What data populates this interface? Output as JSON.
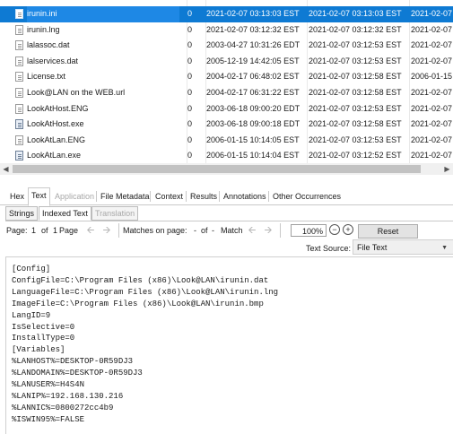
{
  "files": [
    {
      "name": "irunin.ini",
      "size": "0",
      "created": "2021-02-07 03:13:03 EST",
      "modified": "2021-02-07 03:13:03 EST",
      "accessed": "2021-02-07",
      "icon": "doc-icon",
      "selected": true
    },
    {
      "name": "irunin.lng",
      "size": "0",
      "created": "2021-02-07 03:12:32 EST",
      "modified": "2021-02-07 03:12:32 EST",
      "accessed": "2021-02-07",
      "icon": "doc-icon"
    },
    {
      "name": "lalassoc.dat",
      "size": "0",
      "created": "2003-04-27 10:31:26 EDT",
      "modified": "2021-02-07 03:12:53 EST",
      "accessed": "2021-02-07",
      "icon": "doc-icon"
    },
    {
      "name": "lalservices.dat",
      "size": "0",
      "created": "2005-12-19 14:42:05 EST",
      "modified": "2021-02-07 03:12:53 EST",
      "accessed": "2021-02-07",
      "icon": "doc-icon"
    },
    {
      "name": "License.txt",
      "size": "0",
      "created": "2004-02-17 06:48:02 EST",
      "modified": "2021-02-07 03:12:58 EST",
      "accessed": "2006-01-15",
      "icon": "doc-icon"
    },
    {
      "name": "Look@LAN on the WEB.url",
      "size": "0",
      "created": "2004-02-17 06:31:22 EST",
      "modified": "2021-02-07 03:12:58 EST",
      "accessed": "2021-02-07",
      "icon": "doc-icon"
    },
    {
      "name": "LookAtHost.ENG",
      "size": "0",
      "created": "2003-06-18 09:00:20 EDT",
      "modified": "2021-02-07 03:12:53 EST",
      "accessed": "2021-02-07",
      "icon": "doc-icon"
    },
    {
      "name": "LookAtHost.exe",
      "size": "0",
      "created": "2003-06-18 09:00:18 EDT",
      "modified": "2021-02-07 03:12:58 EST",
      "accessed": "2021-02-07",
      "icon": "exe-icon"
    },
    {
      "name": "LookAtLan.ENG",
      "size": "0",
      "created": "2006-01-15 10:14:05 EST",
      "modified": "2021-02-07 03:12:53 EST",
      "accessed": "2021-02-07",
      "icon": "doc-icon"
    },
    {
      "name": "LookAtLan.exe",
      "size": "0",
      "created": "2006-01-15 10:14:04 EST",
      "modified": "2021-02-07 03:12:52 EST",
      "accessed": "2021-02-07",
      "icon": "exe-icon"
    }
  ],
  "tabs": [
    {
      "label": "Hex",
      "enabled": true
    },
    {
      "label": "Text",
      "enabled": true,
      "active": true
    },
    {
      "label": "Application",
      "enabled": false
    },
    {
      "label": "File Metadata",
      "enabled": true
    },
    {
      "label": "Context",
      "enabled": true
    },
    {
      "label": "Results",
      "enabled": true
    },
    {
      "label": "Annotations",
      "enabled": true
    },
    {
      "label": "Other Occurrences",
      "enabled": true
    }
  ],
  "subtabs": [
    {
      "label": "Strings",
      "enabled": true
    },
    {
      "label": "Indexed Text",
      "enabled": true,
      "active": true
    },
    {
      "label": "Translation",
      "enabled": false
    }
  ],
  "toolbar": {
    "page_label": "Page:",
    "page_value": "1",
    "of_label": "of",
    "page_total": "1",
    "page_suffix": "Page",
    "matches_label": "Matches on page:",
    "match_value": "-",
    "match_total": "-",
    "match_suffix": "Match",
    "zoom": "100%",
    "reset": "Reset"
  },
  "text_source": {
    "label": "Text Source:",
    "value": "File Text"
  },
  "content_lines": [
    "[Config]",
    "ConfigFile=C:\\Program Files (x86)\\Look@LAN\\irunin.dat",
    "LanguageFile=C:\\Program Files (x86)\\Look@LAN\\irunin.lng",
    "ImageFile=C:\\Program Files (x86)\\Look@LAN\\irunin.bmp",
    "LangID=9",
    "IsSelective=0",
    "InstallType=0",
    "[Variables]",
    "%LANHOST%=DESKTOP-0R59DJ3",
    "%LANDOMAIN%=DESKTOP-0R59DJ3",
    "%LANUSER%=H4S4N",
    "%LANIP%=192.168.130.216",
    "%LANNIC%=0800272cc4b9",
    "%ISWIN95%=FALSE"
  ]
}
